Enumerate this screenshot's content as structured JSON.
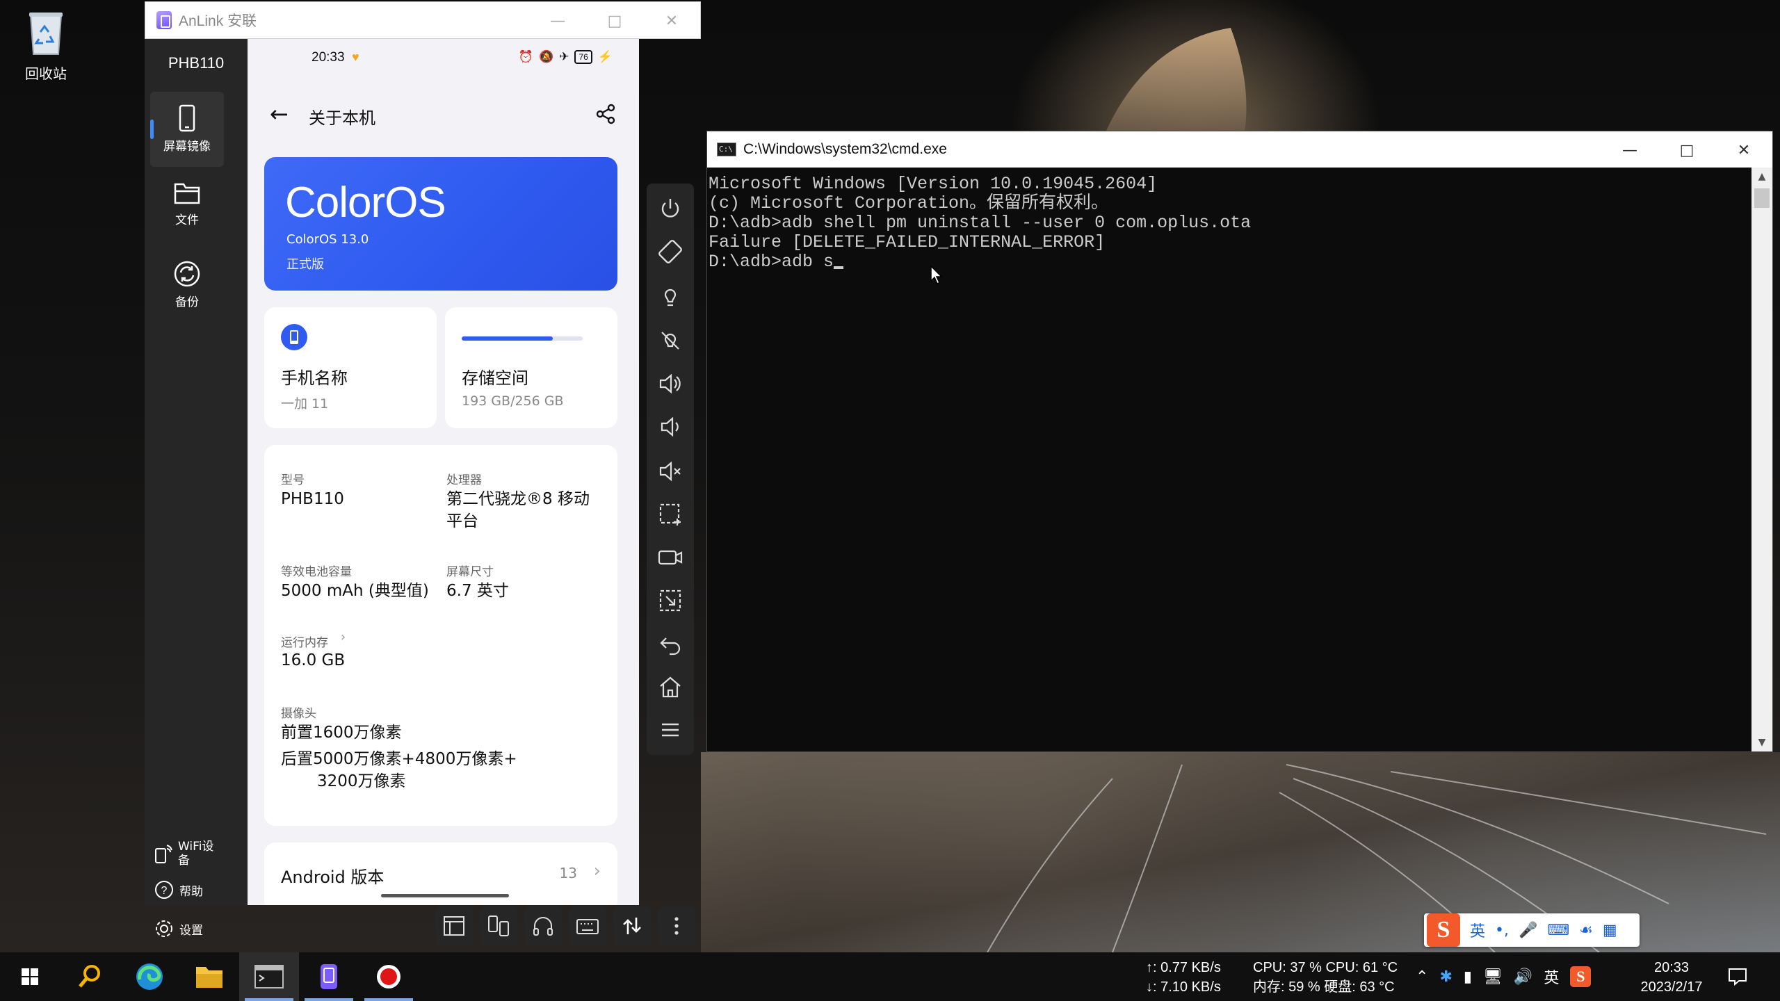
{
  "desktop": {
    "recycle_bin_label": "回收站"
  },
  "anlink": {
    "window_title": "AnLink 安联",
    "device_name": "PHB110",
    "sidebar": [
      {
        "label": "屏幕镜像",
        "icon": "phone-icon",
        "active": true
      },
      {
        "label": "文件",
        "icon": "folder-icon",
        "active": false
      },
      {
        "label": "备份",
        "icon": "sync-icon",
        "active": false
      }
    ],
    "wifi_label": "WiFi设备",
    "help_label": "帮助",
    "settings_label": "设置"
  },
  "phone": {
    "status_time": "20:33",
    "battery": "76",
    "page_title": "关于本机",
    "os_logo": "ColorOS",
    "os_version": "ColorOS 13.0",
    "os_edition": "正式版",
    "phone_name_title": "手机名称",
    "phone_name_value": "一加 11",
    "storage_title": "存储空间",
    "storage_value": "193 GB/256 GB",
    "storage_fraction": 0.754,
    "specs": {
      "model_label": "型号",
      "model_value": "PHB110",
      "cpu_label": "处理器",
      "cpu_value_1": "第二代骁龙®8 移动",
      "cpu_value_2": "平台",
      "battery_label": "等效电池容量",
      "battery_value": "5000 mAh (典型值)",
      "screen_label": "屏幕尺寸",
      "screen_value": "6.7 英寸",
      "ram_label": "运行内存",
      "ram_value": "16.0 GB",
      "camera_label": "摄像头",
      "camera_front": "前置1600万像素",
      "camera_rear_1": "后置5000万像素+4800万像素+",
      "camera_rear_2": "3200万像素"
    },
    "android_label": "Android 版本",
    "android_value": "13"
  },
  "cmd": {
    "window_title": "C:\\Windows\\system32\\cmd.exe",
    "lines": [
      "Microsoft Windows [Version 10.0.19045.2604]",
      "(c) Microsoft Corporation。保留所有权利。",
      "",
      "D:\\adb>adb shell pm uninstall --user 0 com.oplus.ota",
      "Failure [DELETE_FAILED_INTERNAL_ERROR]",
      "",
      "D:\\adb>adb s"
    ]
  },
  "ime": {
    "lang": "英",
    "punct": "•,"
  },
  "taskbar": {
    "net_up": "↑: 0.77 KB/s",
    "net_down": "↓: 7.10 KB/s",
    "cpu": "CPU: 37 %  CPU: 61 °C",
    "mem": "内存: 59 %  硬盘: 63 °C",
    "lang": "英",
    "time": "20:33",
    "date": "2023/2/17"
  }
}
